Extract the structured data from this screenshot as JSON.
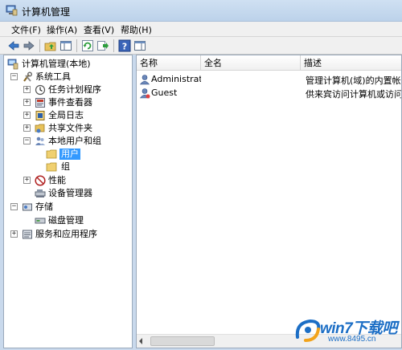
{
  "window": {
    "title": "计算机管理"
  },
  "menu": [
    "文件(F)",
    "操作(A)",
    "查看(V)",
    "帮助(H)"
  ],
  "toolbar": [
    "back-arrow-icon",
    "forward-arrow-icon",
    "folder-up-icon",
    "show-hide-tree-icon",
    "refresh-icon",
    "export-list-icon",
    "help-icon",
    "properties-panel-icon"
  ],
  "tree": {
    "root": "计算机管理(本地)",
    "system_tools": "系统工具",
    "task_scheduler": "任务计划程序",
    "event_viewer": "事件查看器",
    "shared_folders": "共享文件夹",
    "global_log": "全局日志",
    "local_users_groups": "本地用户和组",
    "users": "用户",
    "groups": "组",
    "performance": "性能",
    "device_manager": "设备管理器",
    "storage": "存储",
    "disk_management": "磁盘管理",
    "services_apps": "服务和应用程序",
    "expander_plus": "+",
    "expander_minus": "−"
  },
  "list": {
    "columns": [
      "名称",
      "全名",
      "描述"
    ],
    "rows": [
      {
        "name": "Administrat...",
        "fullname": "",
        "description": "管理计算机(域)的内置帐户"
      },
      {
        "name": "Guest",
        "fullname": "",
        "description": "供来宾访问计算机或访问域"
      }
    ]
  },
  "watermark": {
    "brand": "win7下载吧",
    "url": "www.8495.cn"
  },
  "colors": {
    "titlebar": "#c4d7ed",
    "selection": "#3399ff",
    "watermark": "#1c6ec5"
  }
}
